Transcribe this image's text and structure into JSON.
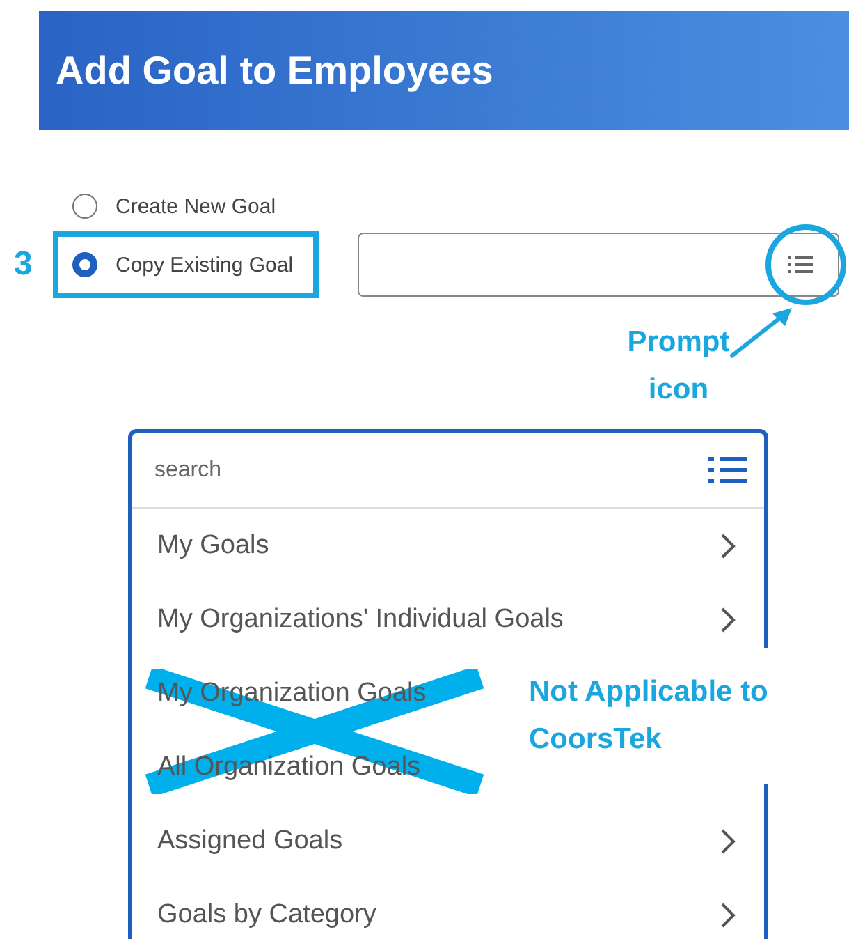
{
  "header": {
    "title": "Add Goal to Employees"
  },
  "options": [
    {
      "label": "Create New Goal",
      "selected": false,
      "highlighted": false
    },
    {
      "label": "Copy Existing Goal",
      "selected": true,
      "highlighted": true
    }
  ],
  "dropdown": {
    "placeholder": "search",
    "items": [
      {
        "label": "My Goals",
        "crossed_out": false
      },
      {
        "label": "My Organizations' Individual Goals",
        "crossed_out": false
      },
      {
        "label": "My Organization Goals",
        "crossed_out": true
      },
      {
        "label": "All Organization Goals",
        "crossed_out": true
      },
      {
        "label": "Assigned Goals",
        "crossed_out": false
      },
      {
        "label": "Goals by Category",
        "crossed_out": false
      }
    ]
  },
  "annotations": {
    "step": "3",
    "prompt_callout": "Prompt icon",
    "note": "Not Applicable to CoorsTek"
  }
}
